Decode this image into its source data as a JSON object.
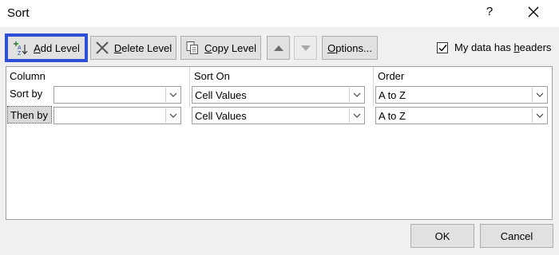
{
  "dialog": {
    "title": "Sort",
    "help_label": "?",
    "close_icon": "close-icon"
  },
  "toolbar": {
    "add_level": {
      "accel": "A",
      "rest": "dd Level",
      "icon": "add-level-icon"
    },
    "delete_level": {
      "accel": "D",
      "rest": "elete Level",
      "icon": "delete-x-icon"
    },
    "copy_level": {
      "accel": "C",
      "rest": "opy Level",
      "icon": "copy-icon"
    },
    "move_up_icon": "triangle-up-icon",
    "move_down_icon": "triangle-down-icon",
    "options": {
      "accel": "O",
      "rest": "ptions..."
    }
  },
  "headers_checkbox": {
    "label_before": "My data has ",
    "accel": "h",
    "label_after": "eaders",
    "checked": true
  },
  "grid": {
    "columns": [
      "Column",
      "Sort On",
      "Order"
    ],
    "rows": [
      {
        "label": "Sort by",
        "column_value": "",
        "sort_on": "Cell Values",
        "order": "A to Z",
        "selected": false
      },
      {
        "label": "Then by",
        "column_value": "",
        "sort_on": "Cell Values",
        "order": "A to Z",
        "selected": true
      }
    ]
  },
  "footer": {
    "ok_label": "OK",
    "cancel_label": "Cancel"
  },
  "colors": {
    "dialog_bg": "#f0f0f0",
    "button_bg": "#e1e1e1",
    "focus_outline": "#2f4fd8",
    "selected_row": "#d9d9d9"
  }
}
